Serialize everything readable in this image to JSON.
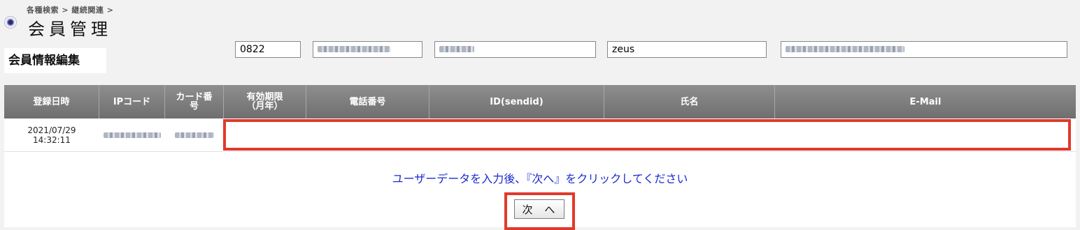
{
  "breadcrumb": "各種検索 > 継続関連 >",
  "page_title": "会員管理",
  "section_title": "会員情報編集",
  "table": {
    "headers": [
      "登録日時",
      "IPコード",
      "カード番\n号",
      "有効期限\n（月年）",
      "電話番号",
      "ID(sendid)",
      "氏名",
      "E-Mail"
    ],
    "row": {
      "registered_at": "2021/07/29\n14:32:11",
      "expiry": "0822",
      "name": "zeus"
    }
  },
  "instruction": "ユーザーデータを入力後、『次へ』をクリックしてください",
  "next_button": "次 へ",
  "colors": {
    "highlight": "#e03a2a",
    "instruction": "#1a2ad0",
    "header_bg": "#7d7d7d"
  }
}
